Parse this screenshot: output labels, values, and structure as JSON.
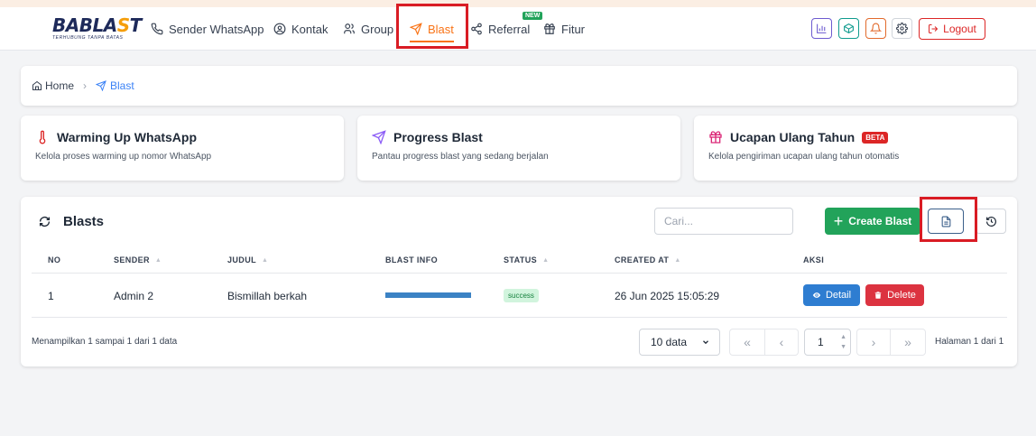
{
  "brand": {
    "logo_text_a": "BABLA",
    "logo_text_b": "S",
    "logo_text_c": "T",
    "tagline": "TERHUBUNG TANPA BATAS"
  },
  "nav": {
    "items": [
      {
        "label": "Sender WhatsApp",
        "icon": "phone-icon"
      },
      {
        "label": "Kontak",
        "icon": "user-circle-icon"
      },
      {
        "label": "Group",
        "icon": "users-icon"
      },
      {
        "label": "Blast",
        "icon": "send-icon",
        "active": true
      },
      {
        "label": "Referral",
        "icon": "share-icon"
      },
      {
        "label": "Fitur",
        "icon": "gift-icon"
      }
    ],
    "new_badge": "NEW",
    "logout_label": "Logout"
  },
  "colors": {
    "accent": "#f97316",
    "primary": "#2e7dd1",
    "success": "#22a35a",
    "danger": "#dc2626",
    "highlight_box": "#d91c24"
  },
  "breadcrumb": {
    "home": "Home",
    "current": "Blast"
  },
  "features": [
    {
      "title": "Warming Up WhatsApp",
      "desc": "Kelola proses warming up nomor WhatsApp",
      "icon": "thermometer-icon"
    },
    {
      "title": "Progress Blast",
      "desc": "Pantau progress blast yang sedang berjalan",
      "icon": "send-icon"
    },
    {
      "title": "Ucapan Ulang Tahun",
      "desc": "Kelola pengiriman ucapan ulang tahun otomatis",
      "icon": "gift-icon",
      "badge": "BETA"
    }
  ],
  "blasts": {
    "title": "Blasts",
    "search_placeholder": "Cari...",
    "create_label": "Create Blast",
    "columns": [
      "NO",
      "SENDER",
      "JUDUL",
      "BLAST INFO",
      "STATUS",
      "CREATED AT",
      "AKSI"
    ],
    "rows": [
      {
        "no": "1",
        "sender": "Admin 2",
        "judul": "Bismillah berkah",
        "blast_progress": 1.0,
        "status": "success",
        "created_at": "26 Jun 2025 15:05:29",
        "detail_label": "Detail",
        "delete_label": "Delete"
      }
    ],
    "footer_info": "Menampilkan 1 sampai 1 dari 1 data",
    "per_page": "10 data",
    "page": "1",
    "page_of": "Halaman 1 dari 1"
  }
}
